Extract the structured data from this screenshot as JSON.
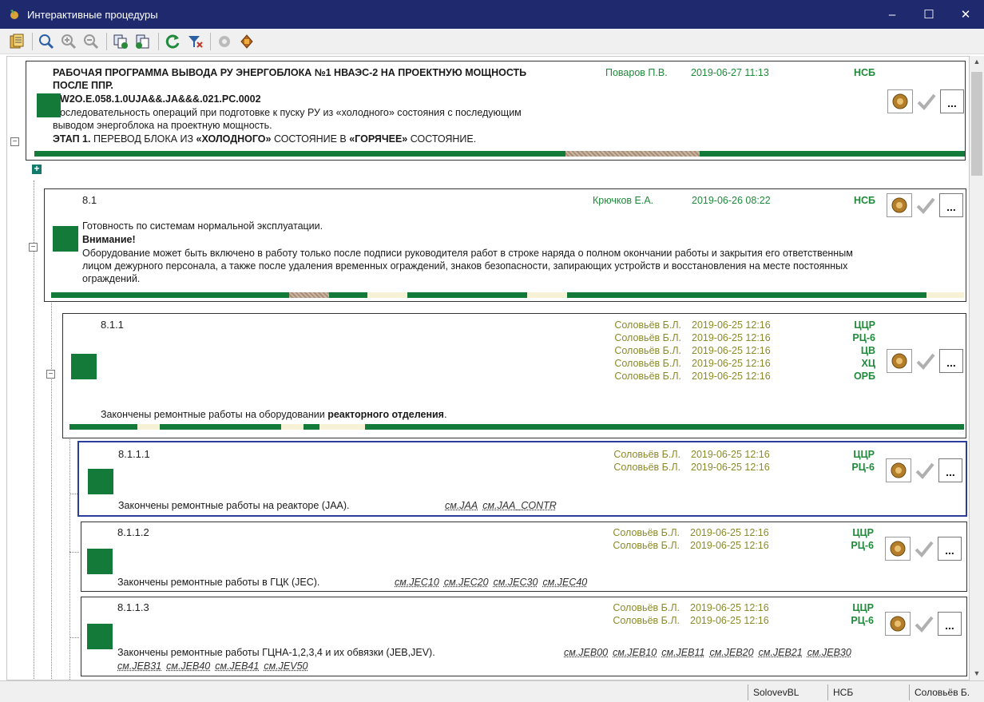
{
  "window": {
    "title": "Интерактивные процедуры",
    "minimize": "‒",
    "maximize": "☐",
    "close": "✕"
  },
  "toolbar": {
    "items": [
      "procedures-icon",
      "zoom-icon",
      "zoom-in-icon",
      "zoom-out-icon",
      "copy-icon",
      "paste-icon",
      "refresh-icon",
      "filter-icon",
      "gear-disabled-icon",
      "book-icon"
    ]
  },
  "main": {
    "title": "РАБОЧАЯ ПРОГРАММА ВЫВОДА РУ ЭНЕРГОБЛОКА №1 НВАЭС-2 НА ПРОЕКТНУЮ МОЩНОСТЬ",
    "title2": "ПОСЛЕ ППР.",
    "code": "NW2O.E.058.1.0UJA&&.JA&&&.021.PC.0002",
    "desc1": "Последовательность операций при подготовке к пуску РУ из «холодного» состояния с последующим",
    "desc2": "выводом энергоблока на проектную мощность.",
    "stage_a": "ЭТАП 1.",
    "stage_b": " ПЕРЕВОД БЛОКА ИЗ ",
    "stage_c": "«ХОЛОДНОГО»",
    "stage_d": " СОСТОЯНИЕ В ",
    "stage_e": "«ГОРЯЧЕЕ»",
    "stage_f": " СОСТОЯНИЕ.",
    "person": "Поваров П.В.",
    "datetime": "2019-06-27 11:13",
    "dept": "НСБ"
  },
  "s81": {
    "num": "8.1",
    "person": "Крючков Е.А.",
    "datetime": "2019-06-26 08:22",
    "dept": "НСБ",
    "line1": "Готовность по системам нормальной эксплуатации.",
    "warn": "Внимание!",
    "line2": "Оборудование может быть включено в работу только после подписи руководителя работ в строке наряда о полном окончании работы и закрытия его ответственным",
    "line3": "лицом дежурного персонала, а также после удаления временных ограждений, знаков безопасности, запирающих устройств и восстановления на месте постоянных",
    "line4": "ограждений."
  },
  "s811": {
    "num": "8.1.1",
    "signers": [
      {
        "person": "Соловьёв Б.Л.",
        "datetime": "2019-06-25 12:16",
        "dept": "ЦЦР"
      },
      {
        "person": "Соловьёв Б.Л.",
        "datetime": "2019-06-25 12:16",
        "dept": "РЦ-6"
      },
      {
        "person": "Соловьёв Б.Л.",
        "datetime": "2019-06-25 12:16",
        "dept": "ЦВ"
      },
      {
        "person": "Соловьёв Б.Л.",
        "datetime": "2019-06-25 12:16",
        "dept": "ХЦ"
      },
      {
        "person": "Соловьёв Б.Л.",
        "datetime": "2019-06-25 12:16",
        "dept": "ОРБ"
      }
    ],
    "text_a": "Закончены ремонтные работы на оборудовании ",
    "text_b": "реакторного отделения",
    "text_c": "."
  },
  "s8111": {
    "num": "8.1.1.1",
    "signers": [
      {
        "person": "Соловьёв Б.Л.",
        "datetime": "2019-06-25 12:16",
        "dept": "ЦЦР"
      },
      {
        "person": "Соловьёв Б.Л.",
        "datetime": "2019-06-25 12:16",
        "dept": "РЦ-6"
      }
    ],
    "text": "Закончены ремонтные работы на реакторе (JAA).",
    "links": [
      "см.JAA",
      "см.JAA_CONTR"
    ]
  },
  "s8112": {
    "num": "8.1.1.2",
    "signers": [
      {
        "person": "Соловьёв Б.Л.",
        "datetime": "2019-06-25 12:16",
        "dept": "ЦЦР"
      },
      {
        "person": "Соловьёв Б.Л.",
        "datetime": "2019-06-25 12:16",
        "dept": "РЦ-6"
      }
    ],
    "text": "Закончены ремонтные работы в ГЦК (JEC).",
    "links": [
      "см.JEC10",
      "см.JEC20",
      "см.JEC30",
      "см.JEC40"
    ]
  },
  "s8113": {
    "num": "8.1.1.3",
    "signers": [
      {
        "person": "Соловьёв Б.Л.",
        "datetime": "2019-06-25 12:16",
        "dept": "ЦЦР"
      },
      {
        "person": "Соловьёв Б.Л.",
        "datetime": "2019-06-25 12:16",
        "dept": "РЦ-6"
      }
    ],
    "text": "Закончены ремонтные работы ГЦНА-1,2,3,4 и их обвязки (JEB,JEV).",
    "links1": [
      "см.JEB00",
      "см.JEB10",
      "см.JEB11",
      "см.JEB20",
      "см.JEB21",
      "см.JEB30"
    ],
    "links2": [
      "см.JEB31",
      "см.JEB40",
      "см.JEB41",
      "см.JEV50"
    ]
  },
  "actions": {
    "more": "..."
  },
  "status": {
    "user": "SolovevBL",
    "role": "НСБ",
    "name": "Соловьёв Б."
  },
  "colors": {
    "titlebar": "#1f2a6e",
    "green": "#137a3a",
    "olive": "#8b8b2a",
    "dept": "#1f8a3a",
    "selection": "#2b3e9a"
  }
}
